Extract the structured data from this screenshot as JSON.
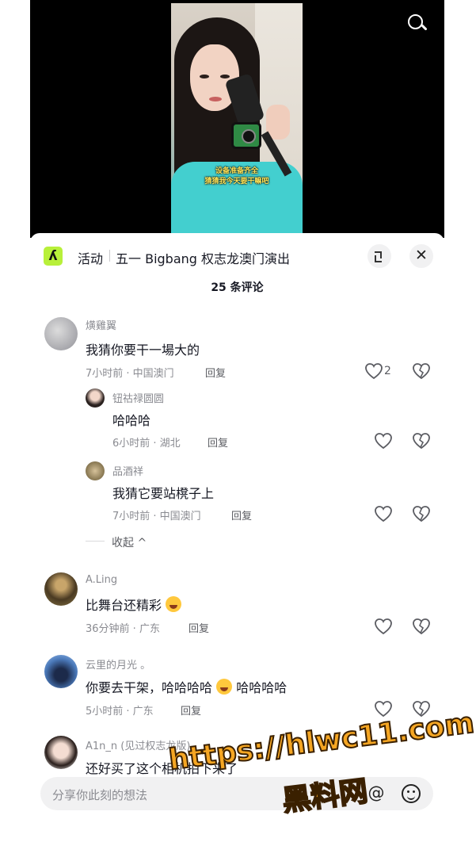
{
  "video": {
    "subtitle_line1": "设备准备齐全",
    "subtitle_line2": "猜猜我今天要干嘛吧"
  },
  "header": {
    "activity_logo_icon": "activity-logo-icon",
    "activity_tag": "活动",
    "activity_title": "五一 Bigbang 权志龙澳门演出",
    "comment_count": "25 条评论"
  },
  "comments": [
    {
      "name": "熿雞翼",
      "text": "我猜你要干一場大的",
      "time_location": "7小时前 · 中国澳门",
      "reply_label": "回复",
      "likes": "2",
      "replies": [
        {
          "name": "钮祜禄圆圆",
          "text": "哈哈哈",
          "time_location": "6小时前 · 湖北",
          "reply_label": "回复"
        },
        {
          "name": "品酒祥",
          "text": "我猜它要站櫈子上",
          "time_location": "7小时前 · 中国澳门",
          "reply_label": "回复"
        }
      ],
      "collapse_label": "收起 ^"
    },
    {
      "name": "A.Ling",
      "text": "比舞台还精彩",
      "emoji": "thinking-face-emoji",
      "time_location": "36分钟前 · 广东",
      "reply_label": "回复"
    },
    {
      "name": "云里的月光 。",
      "text_part1": "你要去干架，哈哈哈哈",
      "text_part2": "哈哈哈哈",
      "emoji": "laughing-face-emoji",
      "time_location": "5小时前 · 广东",
      "reply_label": "回复"
    },
    {
      "name": "A1n_n (见过权志龙版)",
      "text": "还好买了这个相机拍下来了"
    }
  ],
  "input": {
    "placeholder": "分享你此刻的想法",
    "at_icon": "at-icon",
    "emoji_icon": "smile-icon"
  },
  "watermark": {
    "line1": "https://hlwc11.com",
    "line2": "黑料网"
  },
  "colors": {
    "accent_logo": "#b8f03a",
    "text_primary": "#161823",
    "text_secondary": "#8a8b91"
  }
}
